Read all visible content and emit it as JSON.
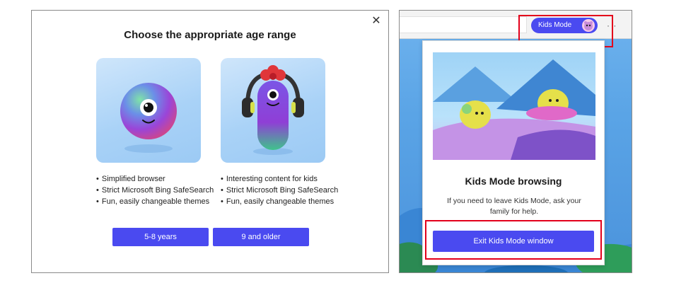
{
  "dialog": {
    "title": "Choose the appropriate age range",
    "close_glyph": "✕",
    "options": [
      {
        "features": [
          "Simplified browser",
          "Strict Microsoft Bing SafeSearch",
          "Fun, easily changeable themes"
        ],
        "button_label": "5-8 years",
        "character_icon": "one-eyed-ball-icon"
      },
      {
        "features": [
          "Interesting content for kids",
          "Strict Microsoft Bing SafeSearch",
          "Fun, easily changeable themes"
        ],
        "button_label": "9 and older",
        "character_icon": "headphones-character-icon"
      }
    ]
  },
  "browser": {
    "kids_mode_pill": "Kids Mode",
    "more_glyph": "· ·",
    "popup": {
      "title": "Kids Mode browsing",
      "text": "If you need to leave Kids Mode, ask your family for help.",
      "exit_button": "Exit Kids Mode window"
    }
  },
  "colors": {
    "accent": "#4a4af0",
    "highlight": "#e3001b",
    "card_bg": "#a9d2f7"
  }
}
